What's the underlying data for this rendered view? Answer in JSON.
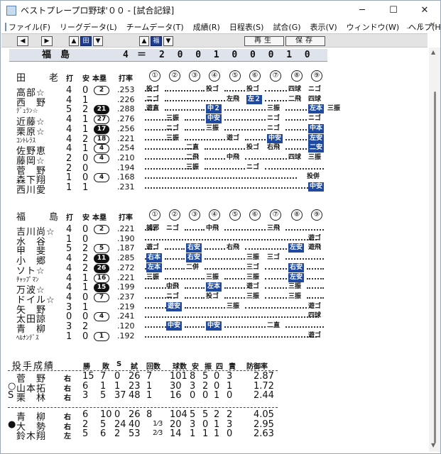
{
  "window": {
    "title": "ベストプレープロ野球'００ - [試合記録]",
    "min": "─",
    "max": "☐",
    "close": "✕"
  },
  "menu": [
    "ファイル(F)",
    "リーグデータ(L)",
    "チームデータ(T)",
    "成績(R)",
    "日程表(S)",
    "試合(G)",
    "表示(V)",
    "ウィンドウ(W)",
    "ヘルプ(H)"
  ],
  "mdi": {
    "min": "_",
    "restore": "▫",
    "close": "✕"
  },
  "toolbar": {
    "left_icon": "arrow-left-icon",
    "right_icon": "arrow-right-icon",
    "team1": "田",
    "team2": "福",
    "replay": "再生",
    "save": "保存"
  },
  "score": {
    "team": "福　島",
    "runs": "4",
    "eq": "＝",
    "innings": [
      "2",
      "0",
      "0",
      "1",
      "0",
      "0",
      "0",
      "1",
      "0"
    ]
  },
  "team1": {
    "name": "田　老",
    "cols": {
      "ab": "打",
      "h": "安",
      "hr": "本塁",
      "avg": "打率"
    },
    "innings": [
      "①",
      "②",
      "③",
      "④",
      "⑤",
      "⑥",
      "⑦",
      "⑧",
      "⑨"
    ],
    "players": [
      {
        "name": "高部☆",
        "ab": "4",
        "h": "0",
        "hr": "2",
        "hrfill": false,
        "avg": ".253"
      },
      {
        "name": "西　野",
        "ab": "4",
        "h": "1",
        "hr": "",
        "hrfill": false,
        "avg": ".226"
      },
      {
        "name": "ﾃﾞｭﾗﾝ☆",
        "ab": "5",
        "h": "2",
        "hr": "21",
        "hrfill": true,
        "avg": ".288"
      },
      {
        "name": "近藤☆",
        "ab": "4",
        "h": "1",
        "hr": "27",
        "hrfill": false,
        "avg": ".276"
      },
      {
        "name": "栗原☆",
        "ab": "4",
        "h": "1",
        "hr": "17",
        "hrfill": true,
        "avg": ".256"
      },
      {
        "name": "ｺﾝﾄﾚﾗｽ",
        "ab": "4",
        "h": "2",
        "hr": "18",
        "hrfill": false,
        "avg": ".221"
      },
      {
        "name": "佐野恵",
        "ab": "4",
        "h": "1",
        "hr": "4",
        "hrfill": false,
        "avg": ".254"
      },
      {
        "name": "藤岡☆",
        "ab": "2",
        "h": "0",
        "hr": "4",
        "hrfill": false,
        "avg": ".210"
      },
      {
        "name": "菅　野",
        "ab": "2",
        "h": "0",
        "hr": "",
        "hrfill": false,
        "avg": ".194"
      },
      {
        "name": "森下翔",
        "ab": "1",
        "h": "0",
        "hr": "4",
        "hrfill": false,
        "avg": ".168"
      },
      {
        "name": "西川愛",
        "ab": "1",
        "h": "1",
        "hr": "",
        "hrfill": false,
        "avg": ".231"
      }
    ]
  },
  "team2": {
    "name": "福　島",
    "cols": {
      "ab": "打",
      "h": "安",
      "hr": "本塁",
      "avg": "打率"
    },
    "innings": [
      "①",
      "②",
      "③",
      "④",
      "⑤",
      "⑥",
      "⑦",
      "⑧",
      "⑨"
    ],
    "players": [
      {
        "name": "吉川尚☆",
        "ab": "4",
        "h": "0",
        "hr": "2",
        "hrfill": false,
        "avg": ".221"
      },
      {
        "name": "水　谷",
        "ab": "1",
        "h": "0",
        "hr": "",
        "hrfill": false,
        "avg": ".190"
      },
      {
        "name": "甲　斐",
        "ab": "5",
        "h": "2",
        "hr": "5",
        "hrfill": false,
        "avg": ".187"
      },
      {
        "name": "小　郷",
        "ab": "4",
        "h": "2",
        "hr": "11",
        "hrfill": true,
        "avg": ".285"
      },
      {
        "name": "ソト☆",
        "ab": "4",
        "h": "2",
        "hr": "26",
        "hrfill": true,
        "avg": ".272"
      },
      {
        "name": "ﾁｬｯﾌﾟﾏﾝ",
        "ab": "4",
        "h": "1",
        "hr": "16",
        "hrfill": false,
        "avg": ".221"
      },
      {
        "name": "万波☆",
        "ab": "4",
        "h": "1",
        "hr": "15",
        "hrfill": true,
        "avg": ".199"
      },
      {
        "name": "ドイル☆",
        "ab": "4",
        "h": "0",
        "hr": "7",
        "hrfill": false,
        "avg": ".237"
      },
      {
        "name": "矢　野",
        "ab": "3",
        "h": "1",
        "hr": "",
        "hrfill": false,
        "avg": ".219"
      },
      {
        "name": "太田諒",
        "ab": "0",
        "h": "0",
        "hr": "4",
        "hrfill": false,
        "avg": ".241"
      },
      {
        "name": "青　柳",
        "ab": "3",
        "h": "2",
        "hr": "",
        "hrfill": false,
        "avg": ".120"
      },
      {
        "name": "ﾍﾙﾅﾝﾃﾞｽ",
        "ab": "1",
        "h": "0",
        "hr": "1",
        "hrfill": false,
        "avg": ".192"
      }
    ]
  },
  "plays1": [
    [
      [
        1,
        "投ゴ",
        0
      ],
      [
        4,
        "投ゴ",
        0
      ],
      [
        6,
        "投ゴ",
        0
      ],
      [
        8,
        "四球",
        0
      ],
      [
        9,
        "ニゴ",
        0
      ]
    ],
    [
      [
        1,
        "ニゴ",
        0
      ],
      [
        5,
        "左飛",
        0
      ],
      [
        6,
        "左２",
        1
      ],
      [
        8,
        "二飛",
        0
      ],
      [
        9,
        "四球",
        0
      ]
    ],
    [
      [
        1,
        "遊直",
        0
      ],
      [
        4,
        "中２",
        1
      ],
      [
        7,
        "三振",
        0
      ],
      [
        9,
        "左本",
        1
      ],
      [
        9.9,
        "三振",
        0
      ]
    ],
    [
      [
        2,
        "三振",
        0
      ],
      [
        4,
        "中安",
        1
      ],
      [
        7,
        "ニゴ",
        0
      ],
      [
        9,
        "ニゴ",
        0
      ]
    ],
    [
      [
        2,
        "ニゴ",
        0
      ],
      [
        4,
        "三振",
        0
      ],
      [
        7,
        "ニゴ",
        0
      ],
      [
        9,
        "中本",
        1
      ]
    ],
    [
      [
        2,
        "三振",
        0
      ],
      [
        5,
        "遊ゴ",
        0
      ],
      [
        7,
        "中安",
        1
      ],
      [
        9,
        "左安",
        1
      ]
    ],
    [
      [
        3,
        "二直",
        0
      ],
      [
        6,
        "投ゴ",
        0
      ],
      [
        7,
        "右飛",
        0
      ],
      [
        9,
        "二安",
        1
      ]
    ],
    [
      [
        3,
        "二飛",
        0
      ],
      [
        5,
        "中飛",
        0
      ],
      [
        8,
        "四球",
        0
      ],
      [
        9,
        "三振",
        0
      ]
    ],
    [
      [
        3,
        "三振",
        0
      ],
      [
        6,
        "ニゴ",
        0
      ]
    ],
    [
      [
        8.6,
        "投併",
        0
      ]
    ],
    [
      [
        9,
        "中安",
        1
      ]
    ]
  ],
  "plays2": [
    [
      [
        1,
        "捕邪",
        0
      ],
      [
        2,
        "ニゴ",
        0
      ],
      [
        4,
        "中飛",
        0
      ],
      [
        7,
        "三飛",
        0
      ]
    ],
    [
      [
        9,
        "遊ゴ",
        0
      ]
    ],
    [
      [
        1,
        "遊ゴ",
        0
      ],
      [
        3,
        "右安",
        1
      ],
      [
        5,
        "右飛",
        0
      ],
      [
        8,
        "左安",
        1
      ],
      [
        9,
        "遊飛",
        0
      ]
    ],
    [
      [
        1,
        "右本",
        1
      ],
      [
        3,
        "右安",
        1
      ],
      [
        6,
        "三振",
        0
      ],
      [
        7,
        "三ゴ",
        0
      ]
    ],
    [
      [
        1,
        "左本",
        1
      ],
      [
        3,
        "二併",
        0
      ],
      [
        6,
        "三ゴ",
        0
      ],
      [
        8,
        "右安",
        1
      ]
    ],
    [
      [
        1,
        "三振",
        0
      ],
      [
        4,
        "三振",
        0
      ],
      [
        6,
        "三振",
        0
      ],
      [
        8,
        "左安",
        1
      ]
    ],
    [
      [
        2,
        "中飛",
        0
      ],
      [
        4,
        "左本",
        1
      ],
      [
        6,
        "遊ゴ",
        0
      ],
      [
        8,
        "三振",
        0
      ]
    ],
    [
      [
        2,
        "ニゴ",
        0
      ],
      [
        4,
        "投ゴ",
        0
      ],
      [
        6,
        "三振",
        0
      ],
      [
        8,
        "三振",
        0
      ]
    ],
    [
      [
        2,
        "遊安",
        1
      ],
      [
        5,
        "三振",
        0
      ],
      [
        9,
        "遊ゴ",
        0
      ]
    ],
    [
      [
        9,
        "四球",
        0
      ]
    ],
    [
      [
        2,
        "中安",
        1
      ],
      [
        4,
        "中安",
        1
      ],
      [
        7,
        "二直",
        0
      ]
    ],
    [
      [
        9,
        "遊ゴ",
        0
      ]
    ]
  ],
  "pitching": {
    "title": "投手成績",
    "cols": [
      "勝",
      "敗",
      "S",
      "試",
      "回数",
      "球数",
      "安",
      "振",
      "四",
      "責",
      "防御率"
    ],
    "group1": [
      {
        "mark": "",
        "name": "菅　野",
        "hand": "右",
        "w": "15",
        "l": "7",
        "s": "0",
        "g": "26",
        "ip": "7",
        "frac": "",
        "np": "101",
        "h": "8",
        "so": "5",
        "bb": "0",
        "er": "3",
        "era": "2.87"
      },
      {
        "mark": "○",
        "name": "山本拓",
        "hand": "右",
        "w": "6",
        "l": "1",
        "s": "1",
        "g": "23",
        "ip": "1",
        "frac": "",
        "np": "30",
        "h": "3",
        "so": "2",
        "bb": "0",
        "er": "1",
        "era": "1.72"
      },
      {
        "mark": "S",
        "name": "栗　林",
        "hand": "右",
        "w": "3",
        "l": "5",
        "s": "37",
        "g": "48",
        "ip": "1",
        "frac": "",
        "np": "16",
        "h": "0",
        "so": "0",
        "bb": "1",
        "er": "0",
        "era": "2.44"
      }
    ],
    "group2": [
      {
        "mark": "",
        "name": "青　柳",
        "hand": "右",
        "w": "6",
        "l": "10",
        "s": "0",
        "g": "26",
        "ip": "8",
        "frac": "",
        "np": "104",
        "h": "5",
        "so": "5",
        "bb": "2",
        "er": "2",
        "era": "4.05"
      },
      {
        "mark": "●",
        "name": "大　勢",
        "hand": "右",
        "w": "2",
        "l": "5",
        "s": "24",
        "g": "40",
        "ip": "",
        "frac": "1⁄3",
        "np": "20",
        "h": "3",
        "so": "0",
        "bb": "1",
        "er": "3",
        "era": "2.95"
      },
      {
        "mark": "",
        "name": "鈴木翔",
        "hand": "左",
        "w": "5",
        "l": "6",
        "s": "2",
        "g": "53",
        "ip": "",
        "frac": "2⁄3",
        "np": "14",
        "h": "1",
        "so": "1",
        "bb": "1",
        "er": "0",
        "era": "2.63"
      }
    ]
  }
}
